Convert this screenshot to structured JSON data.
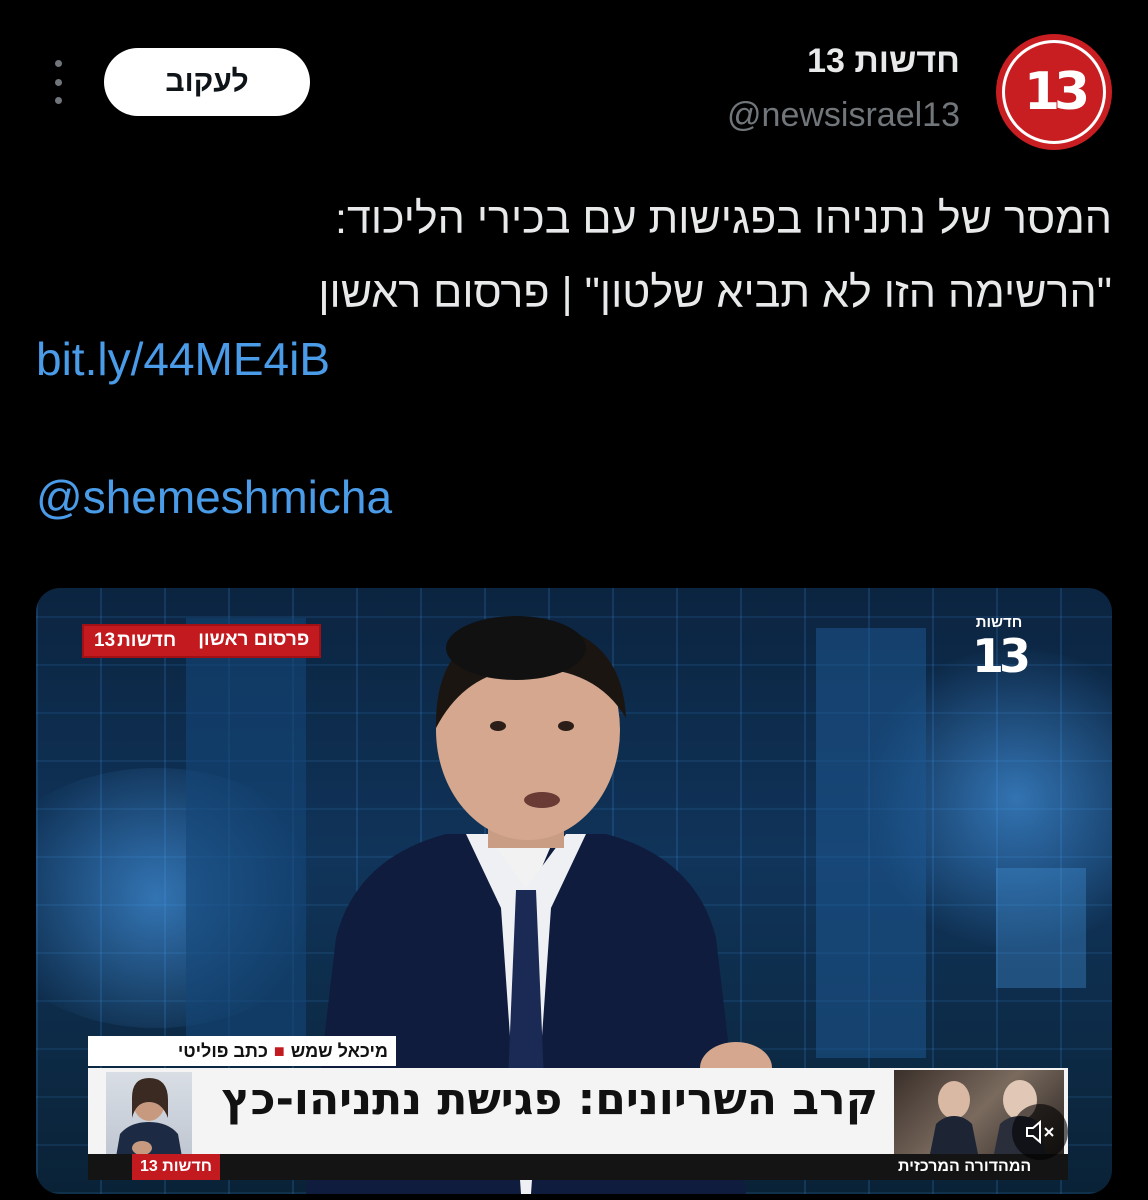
{
  "account": {
    "display_name": "חדשות 13",
    "handle": "@newsisrael13",
    "avatar_text": "13",
    "follow_label": "לעקוב"
  },
  "tweet": {
    "lines": [
      "המסר של נתניהו בפגישות עם בכירי הליכוד:",
      "\"הרשימה הזו לא תביא שלטון\" | פרסום ראשון"
    ],
    "link": "bit.ly/44ME4iB",
    "mention": "@shemeshmicha"
  },
  "media": {
    "live_tag_first": "פרסום ראשון",
    "live_tag_second": "חדשות",
    "live_tag_num": "13",
    "channel_logo_title": "חדשות",
    "channel_logo_number": "13",
    "reporter_name": "מיכאל שמש",
    "reporter_role": "כתב פוליטי",
    "headline": "קרב השריונים: פגישת נתניהו-כץ",
    "bottom_left": "חדשות 13",
    "bottom_right": "המהדורה המרכזית"
  },
  "colors": {
    "brand_red": "#c81e22",
    "link_blue": "#4a9be8",
    "muted_gray": "#71767b"
  },
  "icons": {
    "more": "more-vertical-icon",
    "mute": "speaker-muted-icon"
  }
}
